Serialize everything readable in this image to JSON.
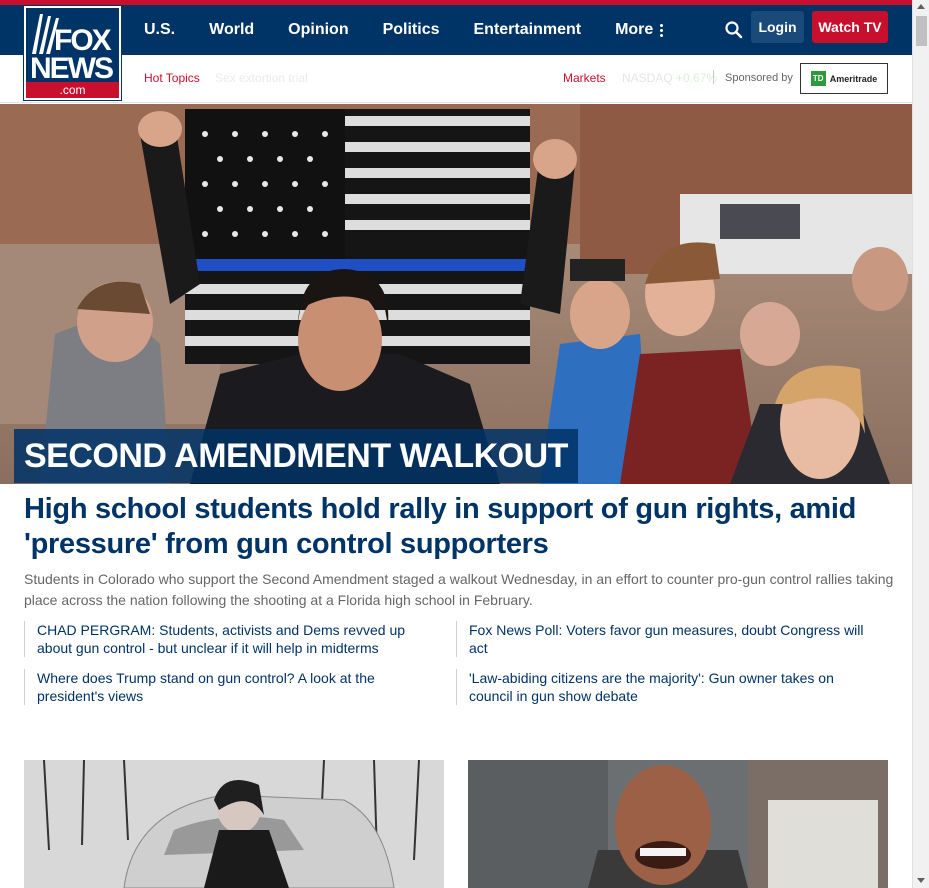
{
  "header": {
    "logo": {
      "top": "FOX",
      "bottom": "NEWS",
      "suffix": ".com"
    },
    "nav": [
      "U.S.",
      "World",
      "Opinion",
      "Politics",
      "Entertainment",
      "More"
    ],
    "login_label": "Login",
    "watch_label": "Watch TV",
    "search_icon": "search-icon"
  },
  "subbar": {
    "hot_topics_label": "Hot Topics",
    "hot_topic_1": "Sex extortion trial",
    "markets_label": "Markets",
    "nasdaq_label": "NASDAQ",
    "nasdaq_value": "+0.67%",
    "sponsored_label": "Sponsored by",
    "sponsor_name": "Ameritrade",
    "sponsor_badge": "TD"
  },
  "hero": {
    "kicker": "SECOND AMENDMENT WALKOUT",
    "headline": "High school students hold rally in support of gun rights, amid 'pressure' from gun control supporters",
    "dek": "Students in Colorado who support the Second Amendment staged a walkout Wednesday, in an effort to counter pro-gun control rallies taking place across the nation following the shooting at a Florida high school in February."
  },
  "related": [
    "CHAD PERGRAM: Students, activists and Dems revved up about gun control - but unclear if it will help in midterms",
    "Fox News Poll: Voters favor gun measures, doubt Congress will act",
    "Where does Trump stand on gun control? A look at the president's views",
    "'Law-abiding citizens are the majority': Gun owner takes on council in gun show debate"
  ],
  "colors": {
    "navy": "#003366",
    "red": "#c8102e"
  }
}
